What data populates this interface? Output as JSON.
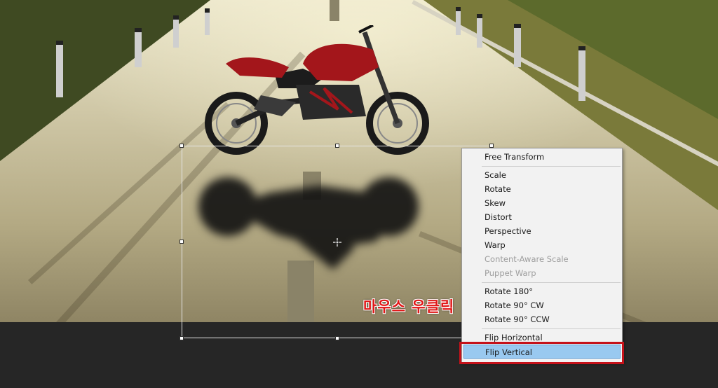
{
  "context_menu": {
    "items": [
      {
        "label": "Free Transform",
        "enabled": true
      },
      {
        "label": "Scale",
        "enabled": true
      },
      {
        "label": "Rotate",
        "enabled": true
      },
      {
        "label": "Skew",
        "enabled": true
      },
      {
        "label": "Distort",
        "enabled": true
      },
      {
        "label": "Perspective",
        "enabled": true
      },
      {
        "label": "Warp",
        "enabled": true
      },
      {
        "label": "Content-Aware Scale",
        "enabled": false
      },
      {
        "label": "Puppet Warp",
        "enabled": false
      },
      {
        "label": "Rotate 180°",
        "enabled": true
      },
      {
        "label": "Rotate 90° CW",
        "enabled": true
      },
      {
        "label": "Rotate 90° CCW",
        "enabled": true
      },
      {
        "label": "Flip Horizontal",
        "enabled": true
      },
      {
        "label": "Flip Vertical",
        "enabled": true,
        "highlighted": true
      }
    ]
  },
  "annotation": {
    "text": "마우스 우클릭",
    "color": "#e01818"
  },
  "colors": {
    "menu_highlight": "#99c9f0",
    "callout_frame": "#c5121a",
    "bike_body": "#a3161b"
  }
}
